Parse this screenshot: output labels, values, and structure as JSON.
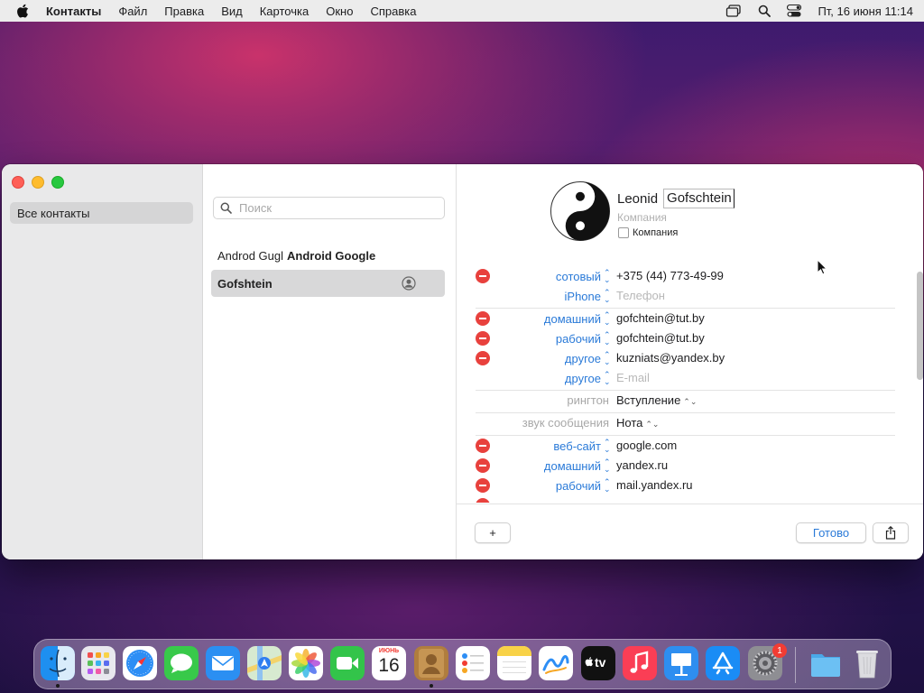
{
  "menubar": {
    "app_name": "Контакты",
    "items": [
      "Файл",
      "Правка",
      "Вид",
      "Карточка",
      "Окно",
      "Справка"
    ],
    "clock": "Пт, 16 июня  11:14"
  },
  "sidebar": {
    "items": [
      {
        "label": "Все контакты",
        "selected": true
      }
    ]
  },
  "search": {
    "placeholder": "Поиск",
    "value": ""
  },
  "contacts": [
    {
      "first": "Androd Gugl",
      "bold": "Android Google",
      "selected": false
    },
    {
      "first": "",
      "bold": "Gofshtein",
      "selected": true,
      "is_me": true
    }
  ],
  "card": {
    "first_name": "Leonid",
    "last_name": "Gofschtein",
    "company_placeholder": "Компания",
    "company_checkbox_label": "Компания",
    "company_checked": false,
    "fields": [
      {
        "label": "сотовый",
        "value": "+375 (44) 773-49-99",
        "deletable": true,
        "label_style": "blue",
        "placeholder": false
      },
      {
        "label": "iPhone",
        "value": "Телефон",
        "deletable": false,
        "label_style": "blue",
        "placeholder": true
      },
      {
        "label": "домашний",
        "value": "gofchtein@tut.by",
        "deletable": true,
        "label_style": "blue",
        "placeholder": false
      },
      {
        "label": "рабочий",
        "value": "gofchtein@tut.by",
        "deletable": true,
        "label_style": "blue",
        "placeholder": false
      },
      {
        "label": "другое",
        "value": "kuzniats@yandex.by",
        "deletable": true,
        "label_style": "blue",
        "placeholder": false
      },
      {
        "label": "другое",
        "value": "E-mail",
        "deletable": false,
        "label_style": "blue",
        "placeholder": true
      },
      {
        "label": "рингтон",
        "value": "Вступление",
        "deletable": false,
        "label_style": "gray",
        "placeholder": false,
        "popup": true
      },
      {
        "label": "звук сообщения",
        "value": "Нота",
        "deletable": false,
        "label_style": "gray",
        "placeholder": false,
        "popup": true
      },
      {
        "label": "веб-сайт",
        "value": "google.com",
        "deletable": true,
        "label_style": "blue",
        "placeholder": false
      },
      {
        "label": "домашний",
        "value": "yandex.ru",
        "deletable": true,
        "label_style": "blue",
        "placeholder": false
      },
      {
        "label": "рабочий",
        "value": "mail.yandex.ru",
        "deletable": true,
        "label_style": "blue",
        "placeholder": false
      }
    ]
  },
  "footer": {
    "add_label": "+",
    "done_label": "Готово"
  },
  "dock": {
    "calendar_month": "ИЮНЬ",
    "calendar_day": "16",
    "tv_label": "tv",
    "settings_badge": "1",
    "apps": [
      "Finder",
      "Launchpad",
      "Safari",
      "Messages",
      "Mail",
      "Maps",
      "Photos",
      "FaceTime",
      "Calendar",
      "Contacts",
      "Reminders",
      "Notes",
      "Freeform",
      "TV",
      "Music",
      "Keynote",
      "App Store",
      "System Settings",
      "Downloads",
      "Trash"
    ]
  },
  "colors": {
    "accent": "#2a7ad8",
    "delete": "#e8413d",
    "selected_row": "#d8d8d9"
  }
}
